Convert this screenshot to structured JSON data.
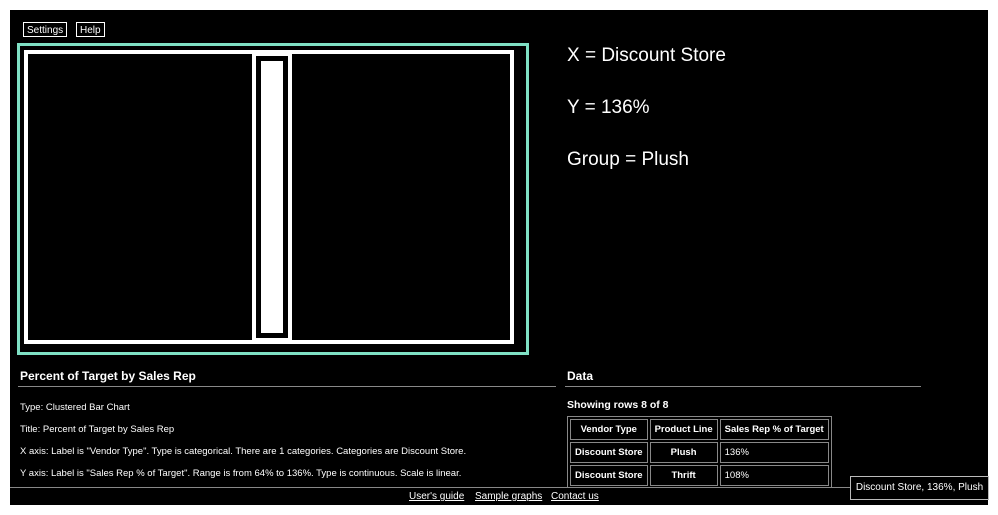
{
  "toolbar": {
    "settings_label": "Settings",
    "help_label": "Help"
  },
  "readout": {
    "x": "X = Discount Store",
    "y": "Y = 136%",
    "group": "Group = Plush"
  },
  "description": {
    "title": "Percent of Target by Sales Rep",
    "lines": [
      "Type: Clustered Bar Chart",
      "Title: Percent of Target by Sales Rep",
      "X axis: Label is \"Vendor Type\". Type is categorical. There are 1 categories. Categories are Discount Store.",
      "Y axis: Label is \"Sales Rep % of Target\". Range is from 64% to 136%. Type is continuous. Scale is linear."
    ]
  },
  "data_section": {
    "title": "Data",
    "showing": "Showing rows 8 of 8",
    "headers": [
      "Vendor Type",
      "Product Line",
      "Sales Rep % of Target"
    ],
    "rows": [
      [
        "Discount Store",
        "Plush",
        "136%"
      ],
      [
        "Discount Store",
        "Thrift",
        "108%"
      ]
    ]
  },
  "chart_data": {
    "type": "bar",
    "categories": [
      "Discount Store"
    ],
    "series": [
      {
        "name": "Plush",
        "values": [
          136
        ]
      }
    ],
    "xlabel": "Vendor Type",
    "ylabel": "Sales Rep % of Target",
    "ylim": [
      64,
      136
    ],
    "highlight_color": "#7fe0c4"
  },
  "footer": {
    "guide": "User's guide",
    "samples": "Sample graphs",
    "contact": "Contact us"
  },
  "tooltip": "Discount Store, 136%, Plush"
}
